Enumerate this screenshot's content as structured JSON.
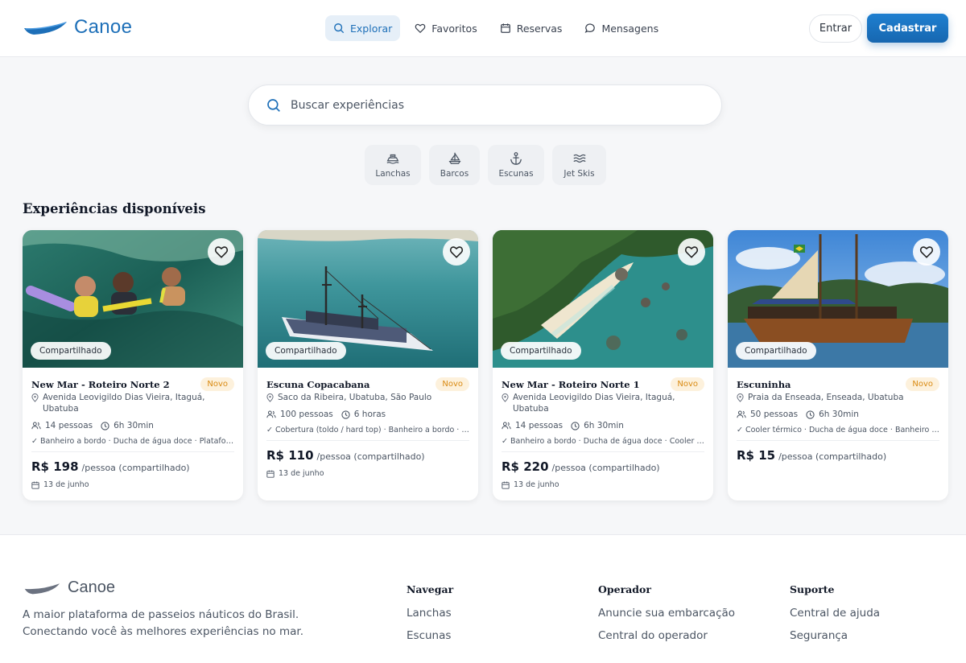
{
  "brand": {
    "name": "Canoe",
    "color": "#1d6fb8"
  },
  "nav": [
    {
      "label": "Explorar",
      "icon": "search-icon",
      "active": true
    },
    {
      "label": "Favoritos",
      "icon": "heart-icon"
    },
    {
      "label": "Reservas",
      "icon": "calendar-icon"
    },
    {
      "label": "Mensagens",
      "icon": "chat-icon"
    }
  ],
  "auth": {
    "login": "Entrar",
    "signup": "Cadastrar"
  },
  "search": {
    "placeholder": "Buscar experiências"
  },
  "categories": [
    {
      "label": "Lanchas",
      "icon": "speedboat-icon"
    },
    {
      "label": "Barcos",
      "icon": "sailboat-icon"
    },
    {
      "label": "Escunas",
      "icon": "anchor-icon"
    },
    {
      "label": "Jet Skis",
      "icon": "waves-icon"
    }
  ],
  "section_title": "Experiências disponíveis",
  "cards": [
    {
      "tag": "Compartilhado",
      "title": "New Mar - Roteiro Norte 2",
      "badge": "Novo",
      "location": "Avenida Leovigildo Dias Vieira, Itaguá, Ubatuba",
      "people": "14 pessoas",
      "duration": "6h 30min",
      "amenities": "✓ Banheiro a bordo · Ducha de água doce · Plataforma de mergulho",
      "price": "R$ 198",
      "price_unit": "/pessoa (compartilhado)",
      "date": "13 de junho"
    },
    {
      "tag": "Compartilhado",
      "title": "Escuna Copacabana",
      "badge": "Novo",
      "location": "Saco da Ribeira, Ubatuba, São Paulo",
      "people": "100 pessoas",
      "duration": "6 horas",
      "amenities": "✓ Cobertura (toldo / hard top) · Banheiro a bordo · Chuveiro",
      "price": "R$ 110",
      "price_unit": "/pessoa (compartilhado)",
      "date": "13 de junho"
    },
    {
      "tag": "Compartilhado",
      "title": "New Mar - Roteiro Norte 1",
      "badge": "Novo",
      "location": "Avenida Leovigildo Dias Vieira, Itaguá, Ubatuba",
      "people": "14 pessoas",
      "duration": "6h 30min",
      "amenities": "✓ Banheiro a bordo · Ducha de água doce · Cooler térmico",
      "price": "R$ 220",
      "price_unit": "/pessoa (compartilhado)",
      "date": "13 de junho"
    },
    {
      "tag": "Compartilhado",
      "title": "Escuninha",
      "badge": "Novo",
      "location": "Praia da Enseada, Enseada, Ubatuba",
      "people": "50 pessoas",
      "duration": "6h 30min",
      "amenities": "✓ Cooler térmico · Ducha de água doce · Banheiro a bordo",
      "price": "R$ 15",
      "price_unit": "/pessoa (compartilhado)",
      "date": ""
    }
  ],
  "footer": {
    "brand": "Canoe",
    "description": "A maior plataforma de passeios náuticos do Brasil. Conectando você às melhores experiências no mar.",
    "columns": [
      {
        "title": "Navegar",
        "links": [
          "Lanchas",
          "Escunas"
        ]
      },
      {
        "title": "Operador",
        "links": [
          "Anuncie sua embarcação",
          "Central do operador"
        ]
      },
      {
        "title": "Suporte",
        "links": [
          "Central de ajuda",
          "Segurança"
        ]
      }
    ]
  }
}
